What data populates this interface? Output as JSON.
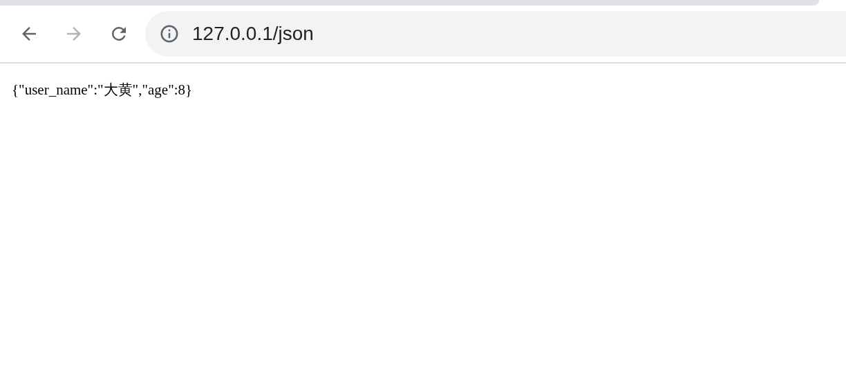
{
  "toolbar": {
    "buttons": [
      {
        "kind": "back",
        "disabled": false
      },
      {
        "kind": "forward",
        "disabled": true
      },
      {
        "kind": "reload",
        "disabled": false
      }
    ]
  },
  "address_bar": {
    "url": "127.0.0.1/json"
  },
  "page": {
    "text": "{\"user_name\":\"大黄\",\"age\":8}"
  }
}
